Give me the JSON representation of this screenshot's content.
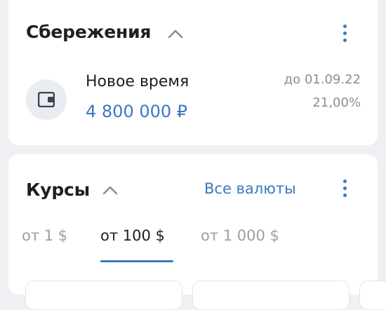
{
  "savings": {
    "title": "Сбережения",
    "account": {
      "name": "Новое время",
      "amount": "4 800 000 ₽",
      "until": "до 01.09.22",
      "rate": "21,00%"
    }
  },
  "rates": {
    "title": "Курсы",
    "all_currencies_label": "Все валюты",
    "tabs": [
      {
        "label": "от 1 $",
        "active": false
      },
      {
        "label": "от 100 $",
        "active": true
      },
      {
        "label": "от 1 000 $",
        "active": false
      }
    ]
  },
  "colors": {
    "accent": "#3a78c3",
    "muted": "#8a8f96",
    "background": "#eef0f3"
  }
}
